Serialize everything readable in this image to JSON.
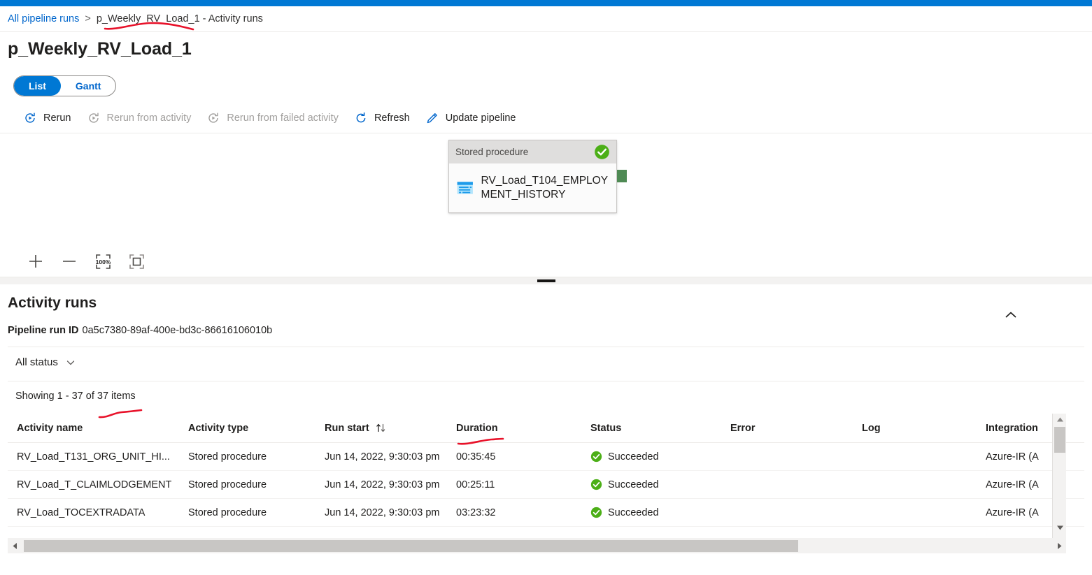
{
  "theme": {
    "accent": "#0078d4",
    "link": "#0066cc",
    "success_green": "#4caf17",
    "connector_green": "#4f8a54",
    "ink_red": "#e8122a"
  },
  "breadcrumb": {
    "root_label": "All pipeline runs",
    "separator": ">",
    "current_label": "p_Weekly_RV_Load_1 - Activity runs"
  },
  "page_title": "p_Weekly_RV_Load_1",
  "view_toggle": {
    "options": [
      {
        "label": "List",
        "active": true
      },
      {
        "label": "Gantt",
        "active": false
      }
    ]
  },
  "command_bar": {
    "items": [
      {
        "label": "Rerun",
        "icon": "rerun-icon",
        "disabled": false
      },
      {
        "label": "Rerun from activity",
        "icon": "rerun-from-activity-icon",
        "disabled": true
      },
      {
        "label": "Rerun from failed activity",
        "icon": "rerun-from-failed-activity-icon",
        "disabled": true
      },
      {
        "label": "Refresh",
        "icon": "refresh-icon",
        "disabled": false
      },
      {
        "label": "Update pipeline",
        "icon": "pencil-icon",
        "disabled": false
      }
    ]
  },
  "graph": {
    "node": {
      "type_label": "Stored procedure",
      "title": "RV_Load_T104_EMPLOYMENT_HISTORY",
      "status": "succeeded",
      "icon": "stored-procedure-icon"
    }
  },
  "zoom_controls": {
    "items": [
      {
        "name": "zoom-in-icon",
        "label": "+"
      },
      {
        "name": "zoom-out-icon",
        "label": "—"
      },
      {
        "name": "zoom-100-percent-icon",
        "label": "100%"
      },
      {
        "name": "fit-to-screen-icon",
        "label": ""
      }
    ]
  },
  "activity_runs": {
    "heading": "Activity runs",
    "collapse_icon": "chevron-up-icon",
    "pipeline_run_id_label": "Pipeline run ID",
    "pipeline_run_id_value": "0a5c7380-89af-400e-bd3c-86616106010b",
    "status_filter_label": "All status",
    "status_filter_icon": "chevron-down-icon",
    "showing_text": "Showing 1 - 37 of 37 items",
    "columns": [
      {
        "key": "activity_name",
        "label": "Activity name",
        "sortable": false
      },
      {
        "key": "activity_type",
        "label": "Activity type",
        "sortable": false
      },
      {
        "key": "run_start",
        "label": "Run start",
        "sortable": true,
        "sort_icon": "sort-arrows-icon"
      },
      {
        "key": "duration",
        "label": "Duration",
        "sortable": false
      },
      {
        "key": "status",
        "label": "Status",
        "sortable": false
      },
      {
        "key": "error",
        "label": "Error",
        "sortable": false
      },
      {
        "key": "log",
        "label": "Log",
        "sortable": false
      },
      {
        "key": "integration_runtime",
        "label": "Integration",
        "sortable": false
      }
    ],
    "rows": [
      {
        "activity_name": "RV_Load_T131_ORG_UNIT_HI...",
        "activity_type": "Stored procedure",
        "run_start": "Jun 14, 2022, 9:30:03 pm",
        "duration": "00:35:45",
        "status": "Succeeded",
        "error": "",
        "log": "",
        "integration_runtime": "Azure-IR (A"
      },
      {
        "activity_name": "RV_Load_T_CLAIMLODGEMENT",
        "activity_type": "Stored procedure",
        "run_start": "Jun 14, 2022, 9:30:03 pm",
        "duration": "00:25:11",
        "status": "Succeeded",
        "error": "",
        "log": "",
        "integration_runtime": "Azure-IR (A"
      },
      {
        "activity_name": "RV_Load_TOCEXTRADATA",
        "activity_type": "Stored procedure",
        "run_start": "Jun 14, 2022, 9:30:03 pm",
        "duration": "03:23:32",
        "status": "Succeeded",
        "error": "",
        "log": "",
        "integration_runtime": "Azure-IR (A"
      }
    ]
  },
  "annotations": [
    {
      "name": "ink-underline-breadcrumb",
      "color": "#e8122a"
    },
    {
      "name": "ink-underline-activity-name",
      "color": "#e8122a"
    },
    {
      "name": "ink-underline-duration",
      "color": "#e8122a"
    }
  ]
}
